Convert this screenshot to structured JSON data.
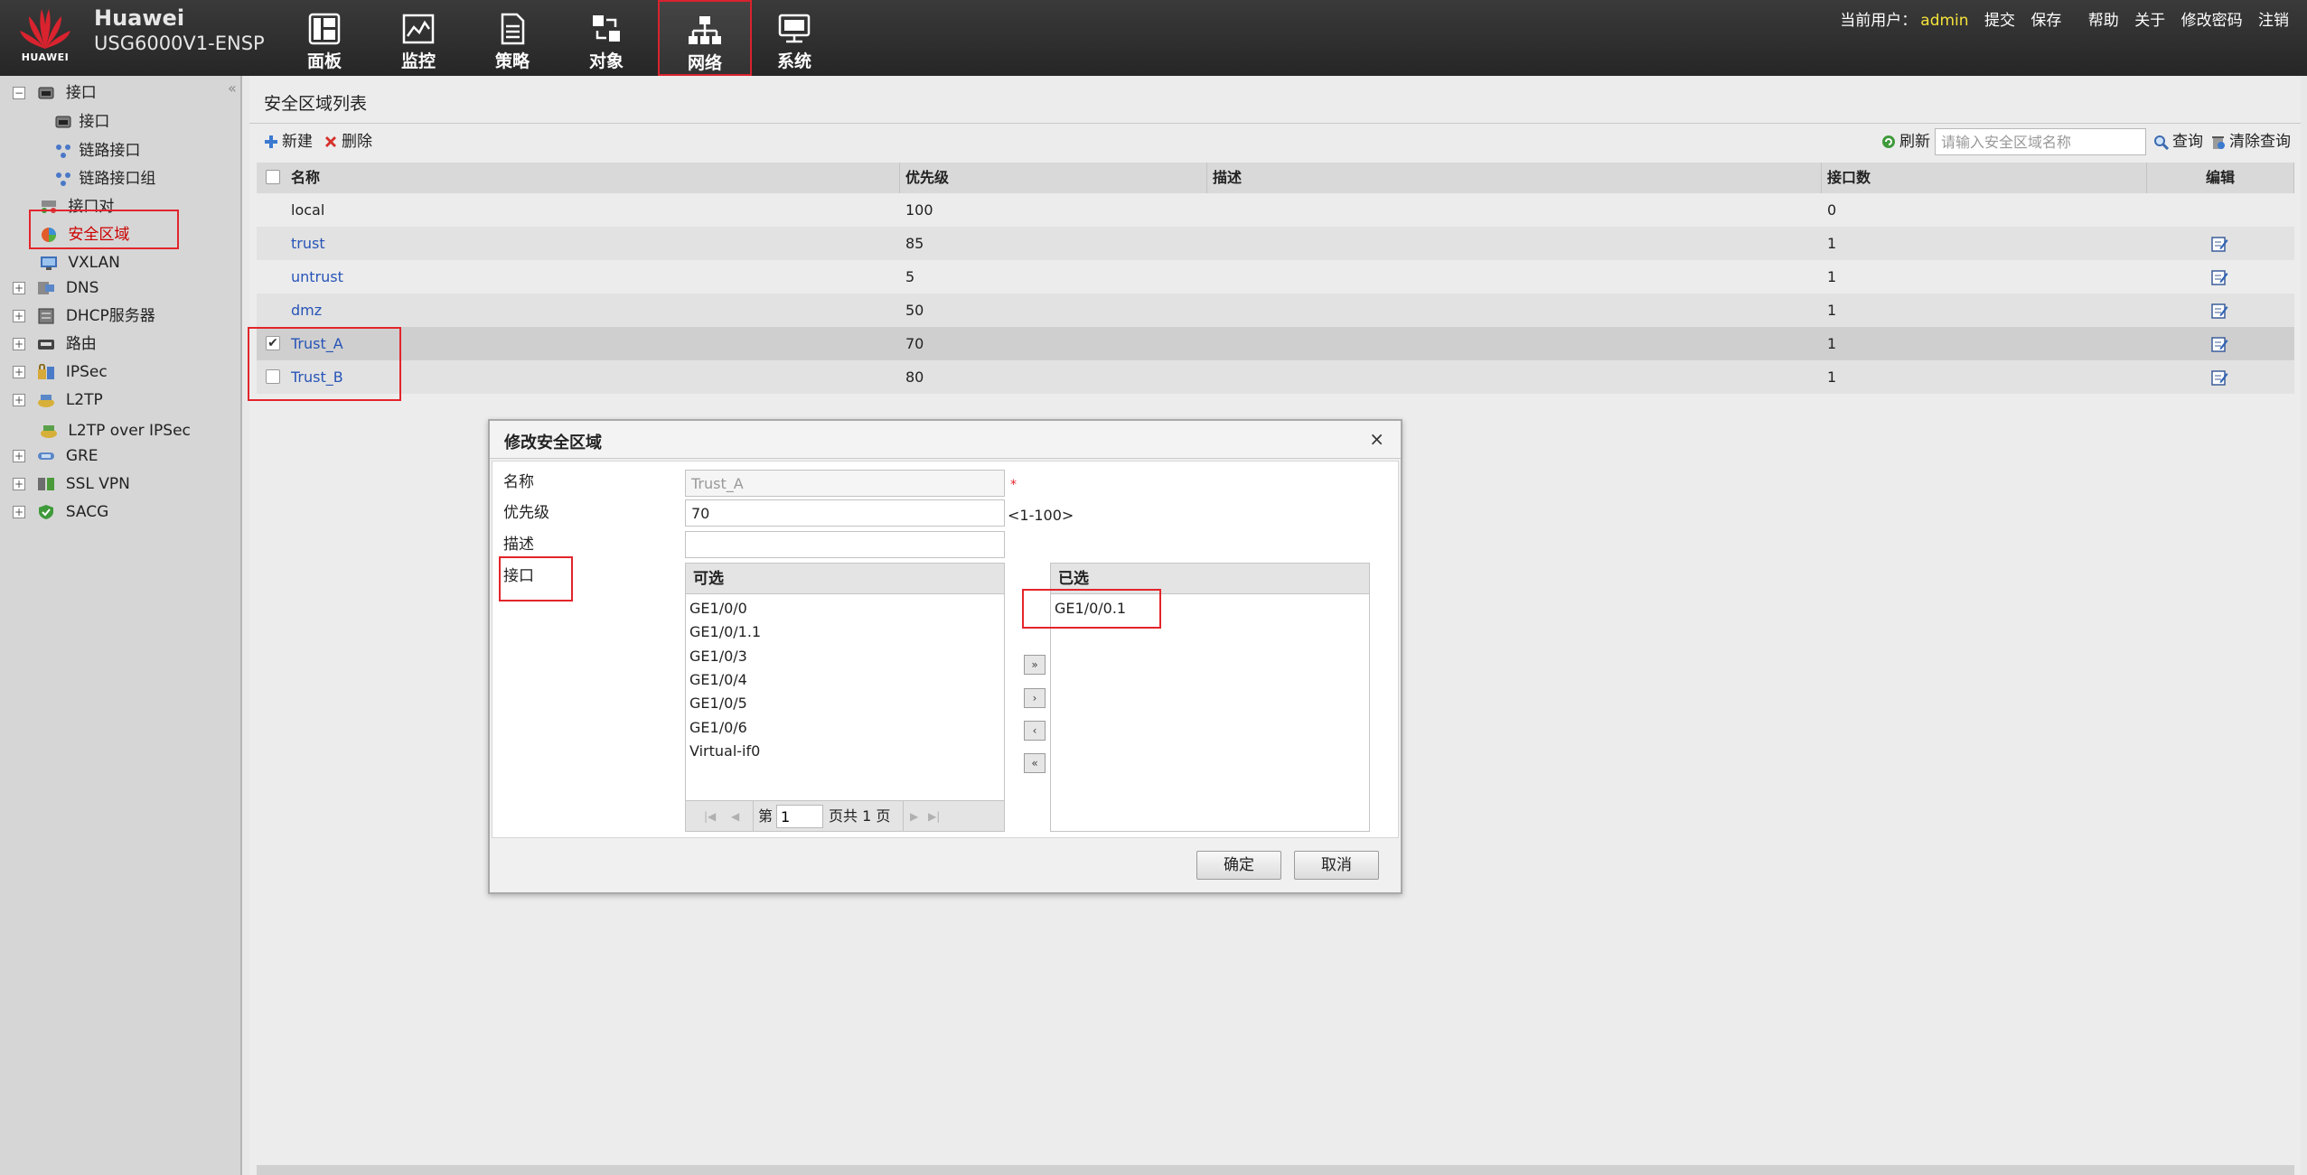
{
  "header": {
    "logo_text": "HUAWEI",
    "product_name": "Huawei",
    "product_model": "USG6000V1-ENSP",
    "nav_tabs": [
      {
        "label": "面板",
        "icon": "dashboard-icon"
      },
      {
        "label": "监控",
        "icon": "monitor-icon"
      },
      {
        "label": "策略",
        "icon": "policy-icon"
      },
      {
        "label": "对象",
        "icon": "object-icon"
      },
      {
        "label": "网络",
        "icon": "network-icon",
        "active": true
      },
      {
        "label": "系统",
        "icon": "system-icon"
      }
    ],
    "current_user_prefix": "当前用户：",
    "current_user": "admin",
    "links": [
      "提交",
      "保存",
      "帮助",
      "关于",
      "修改密码",
      "注销"
    ]
  },
  "sidebar": {
    "collapse_glyph": "«",
    "items": [
      {
        "label": "接口",
        "expander": "−",
        "icon": "interface-icon"
      },
      {
        "label": "接口",
        "icon": "interface-icon"
      },
      {
        "label": "链路接口",
        "icon": "link-interface-icon"
      },
      {
        "label": "链路接口组",
        "icon": "link-interface-group-icon"
      },
      {
        "label": "接口对",
        "icon": "interface-pair-icon"
      },
      {
        "label": "安全区域",
        "icon": "security-zone-icon",
        "selected": true
      },
      {
        "label": "VXLAN",
        "icon": "vxlan-icon"
      },
      {
        "label": "DNS",
        "expander": "+",
        "icon": "dns-icon"
      },
      {
        "label": "DHCP服务器",
        "expander": "+",
        "icon": "dhcp-server-icon"
      },
      {
        "label": "路由",
        "expander": "+",
        "icon": "route-icon"
      },
      {
        "label": "IPSec",
        "expander": "+",
        "icon": "ipsec-icon"
      },
      {
        "label": "L2TP",
        "expander": "+",
        "icon": "l2tp-icon"
      },
      {
        "label": "L2TP over IPSec",
        "icon": "l2tp-over-ipsec-icon"
      },
      {
        "label": "GRE",
        "expander": "+",
        "icon": "gre-icon"
      },
      {
        "label": "SSL VPN",
        "expander": "+",
        "icon": "ssl-vpn-icon"
      },
      {
        "label": "SACG",
        "expander": "+",
        "icon": "sacg-icon"
      }
    ]
  },
  "main": {
    "title": "安全区域列表",
    "toolbar": {
      "new_label": "新建",
      "delete_label": "删除",
      "refresh_label": "刷新",
      "search_placeholder": "请输入安全区域名称",
      "query_label": "查询",
      "clear_query_label": "清除查询"
    },
    "table": {
      "columns": [
        "名称",
        "优先级",
        "描述",
        "接口数",
        "编辑"
      ],
      "rows": [
        {
          "name": "local",
          "priority": "100",
          "description": "",
          "interface_count": "0",
          "link": false,
          "editable": false,
          "checkbox": false
        },
        {
          "name": "trust",
          "priority": "85",
          "description": "",
          "interface_count": "1",
          "link": true,
          "editable": true,
          "checkbox": false
        },
        {
          "name": "untrust",
          "priority": "5",
          "description": "",
          "interface_count": "1",
          "link": true,
          "editable": true,
          "checkbox": false
        },
        {
          "name": "dmz",
          "priority": "50",
          "description": "",
          "interface_count": "1",
          "link": true,
          "editable": true,
          "checkbox": false
        },
        {
          "name": "Trust_A",
          "priority": "70",
          "description": "",
          "interface_count": "1",
          "link": true,
          "editable": true,
          "checkbox": true,
          "checked": true,
          "highlighted": true
        },
        {
          "name": "Trust_B",
          "priority": "80",
          "description": "",
          "interface_count": "1",
          "link": true,
          "editable": true,
          "checkbox": true,
          "checked": false
        }
      ]
    }
  },
  "dialog": {
    "title": "修改安全区域",
    "close_glyph": "×",
    "fields": {
      "name_label": "名称",
      "name_value": "Trust_A",
      "required_mark": "*",
      "priority_label": "优先级",
      "priority_value": "70",
      "priority_hint": "<1-100>",
      "description_label": "描述",
      "description_value": "",
      "interface_label": "接口"
    },
    "available": {
      "header": "可选",
      "items": [
        "GE1/0/0",
        "GE1/0/1.1",
        "GE1/0/3",
        "GE1/0/4",
        "GE1/0/5",
        "GE1/0/6",
        "Virtual-if0"
      ],
      "pager": {
        "page_prefix": "第",
        "page_value": "1",
        "page_suffix": "页共 1 页"
      }
    },
    "selected": {
      "header": "已选",
      "items": [
        "GE1/0/0.1"
      ]
    },
    "move_buttons": [
      "»",
      "›",
      "‹",
      "«"
    ],
    "ok_label": "确定",
    "cancel_label": "取消"
  },
  "colors": {
    "header_bg": "#2e2e2e",
    "active_outline": "#e3242b",
    "link": "#2754b7",
    "user_name": "#f4e23b"
  }
}
